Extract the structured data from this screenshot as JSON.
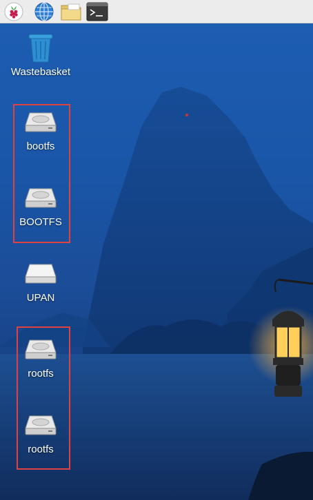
{
  "taskbar": {
    "buttons": [
      {
        "name": "raspberry-menu",
        "icon": "raspberry-icon"
      },
      {
        "name": "web-browser",
        "icon": "globe-icon"
      },
      {
        "name": "file-manager",
        "icon": "folder-icon"
      },
      {
        "name": "terminal",
        "icon": "terminal-icon"
      }
    ]
  },
  "desktop": {
    "icons": [
      {
        "label": "Wastebasket",
        "icon": "trash-icon"
      },
      {
        "label": "bootfs",
        "icon": "drive-icon"
      },
      {
        "label": "BOOTFS",
        "icon": "drive-icon"
      },
      {
        "label": "UPAN",
        "icon": "removable-drive-icon"
      },
      {
        "label": "rootfs",
        "icon": "drive-icon"
      },
      {
        "label": "rootfs",
        "icon": "drive-icon"
      }
    ],
    "annotations": {
      "highlight_color": "#e04141"
    }
  },
  "colors": {
    "panel": "#ececec",
    "desktop_blue": "#1a56a8",
    "lantern_glow": "#ffb43c"
  }
}
